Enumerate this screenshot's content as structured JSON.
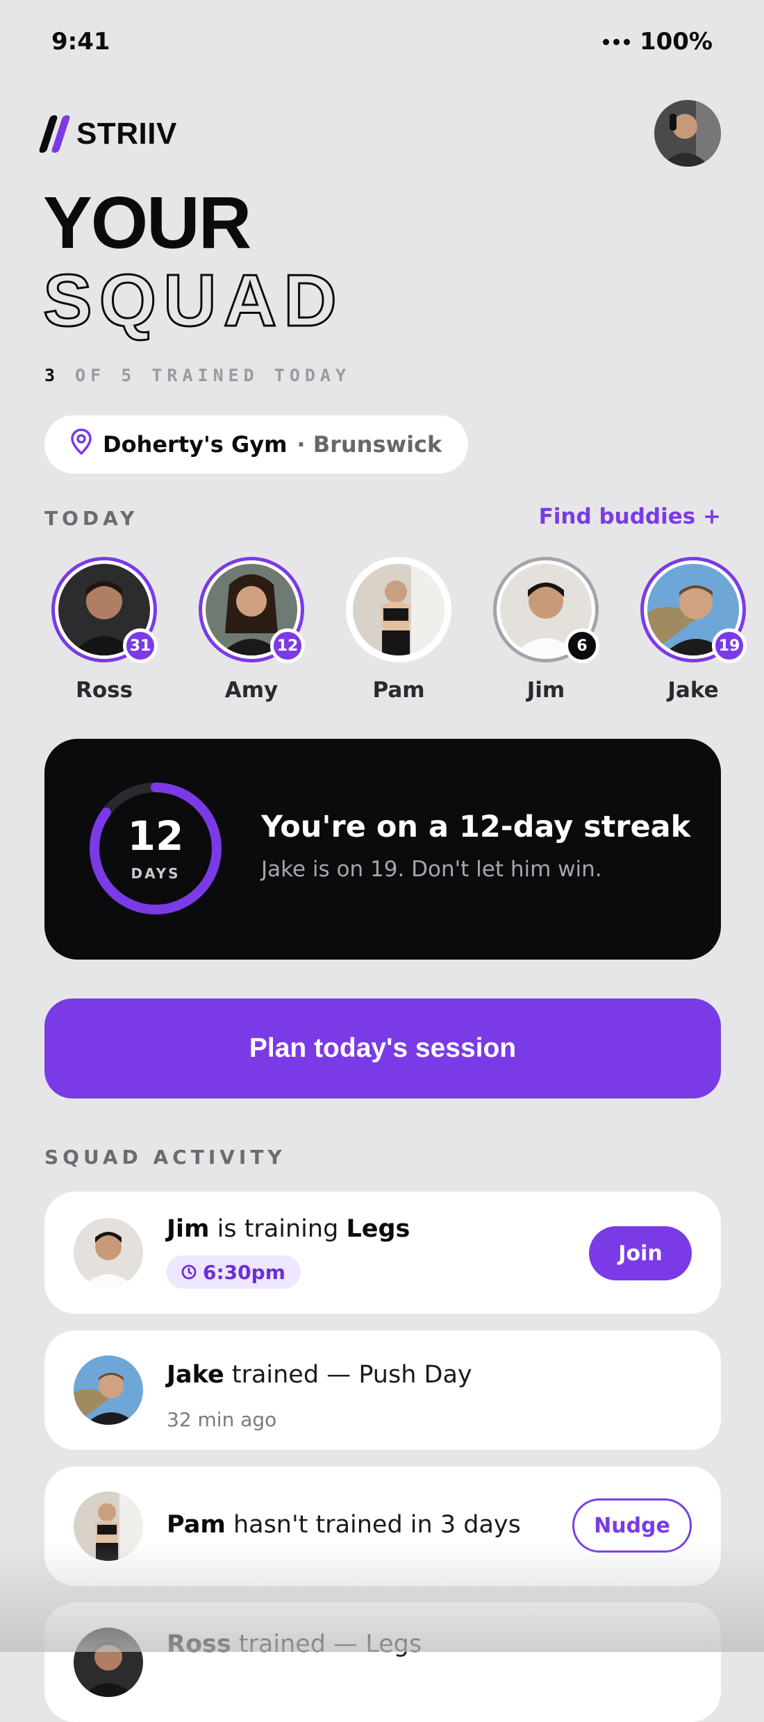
{
  "status_bar": {
    "time": "9:41",
    "battery": "100%"
  },
  "app": {
    "name": "STRIIV"
  },
  "header": {
    "title_line1": "YOUR",
    "title_line2": "SQUAD",
    "trained_count": "3",
    "trained_rest": " OF 5 TRAINED TODAY"
  },
  "gym": {
    "name": "Doherty's Gym",
    "suburb": "· Brunswick"
  },
  "today": {
    "label": "TODAY",
    "find_buddies": "Find buddies +",
    "buddies": [
      {
        "name": "Ross",
        "streak": "31"
      },
      {
        "name": "Amy",
        "streak": "12"
      },
      {
        "name": "Pam",
        "streak": ""
      },
      {
        "name": "Jim",
        "streak": "6"
      },
      {
        "name": "Jake",
        "streak": "19"
      }
    ]
  },
  "streak": {
    "days": "12",
    "days_label": "DAYS",
    "progress": 0.85,
    "title": "You're on a 12-day streak",
    "subtitle": "Jake is on 19. Don't let him win."
  },
  "plan_button": "Plan today's session",
  "activity": {
    "label": "SQUAD ACTIVITY",
    "items": [
      {
        "name": "Jim",
        "text1": " is training ",
        "workout": "Legs",
        "time": "6:30pm",
        "action": "Join"
      },
      {
        "name": "Jake",
        "text1": " trained — Push Day",
        "meta": "32 min ago"
      },
      {
        "name": "Pam",
        "text1": " hasn't trained in 3 days",
        "action": "Nudge"
      },
      {
        "name": "Ross",
        "text1": " trained — Legs"
      }
    ]
  },
  "colors": {
    "accent": "#7a3be6",
    "background": "#e6e6e8",
    "card_dark": "#0b0b0d"
  }
}
